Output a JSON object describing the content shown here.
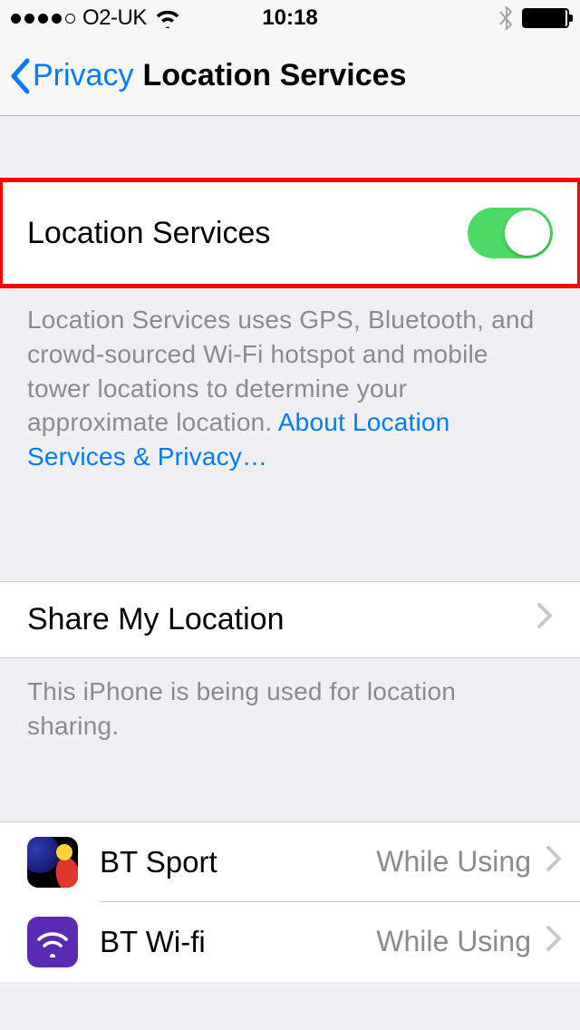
{
  "status_bar": {
    "carrier": "O2-UK",
    "time": "10:18"
  },
  "nav": {
    "back_label": "Privacy",
    "title": "Location Services"
  },
  "location_services": {
    "label": "Location Services",
    "enabled": true,
    "description": "Location Services uses GPS, Bluetooth, and crowd-sourced Wi-Fi hotspot and mobile tower locations to determine your approximate location.",
    "link_label": "About Location Services & Privacy…"
  },
  "share_my_location": {
    "label": "Share My Location",
    "footer": "This iPhone is being used for location sharing."
  },
  "apps": [
    {
      "name": "BT Sport",
      "status": "While Using",
      "icon": "bt-sport-icon"
    },
    {
      "name": "BT Wi-fi",
      "status": "While Using",
      "icon": "bt-wifi-icon"
    }
  ]
}
